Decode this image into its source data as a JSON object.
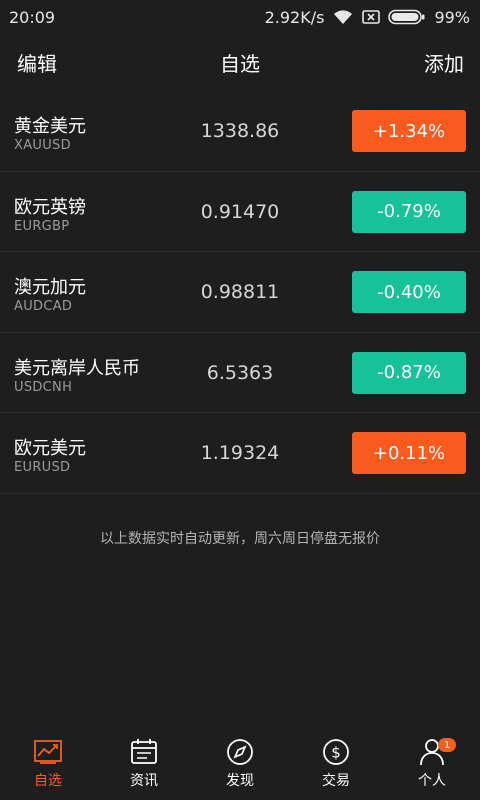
{
  "status_bar": {
    "time": "20:09",
    "network_speed": "2.92K/s",
    "battery": "99%"
  },
  "nav": {
    "edit_label": "编辑",
    "title": "自选",
    "add_label": "添加"
  },
  "quotes": [
    {
      "name": "黄金美元",
      "code": "XAUUSD",
      "price": "1338.86",
      "change": "+1.34%",
      "direction": "up"
    },
    {
      "name": "欧元英镑",
      "code": "EURGBP",
      "price": "0.91470",
      "change": "-0.79%",
      "direction": "down"
    },
    {
      "name": "澳元加元",
      "code": "AUDCAD",
      "price": "0.98811",
      "change": "-0.40%",
      "direction": "down"
    },
    {
      "name": "美元离岸人民币",
      "code": "USDCNH",
      "price": "6.5363",
      "change": "-0.87%",
      "direction": "down"
    },
    {
      "name": "欧元美元",
      "code": "EURUSD",
      "price": "1.19324",
      "change": "+0.11%",
      "direction": "up"
    }
  ],
  "footer_note": "以上数据实时自动更新，周六周日停盘无报价",
  "tabs": [
    {
      "label": "自选",
      "icon": "chart-icon",
      "active": true
    },
    {
      "label": "资讯",
      "icon": "calendar-news-icon",
      "active": false
    },
    {
      "label": "发现",
      "icon": "compass-icon",
      "active": false
    },
    {
      "label": "交易",
      "icon": "dollar-coin-icon",
      "active": false
    },
    {
      "label": "个人",
      "icon": "person-icon",
      "active": false,
      "badge": "1"
    }
  ],
  "colors": {
    "background": "#1e1e1e",
    "up": "#fa5a1e",
    "down": "#17c199",
    "accent": "#f0601f"
  }
}
